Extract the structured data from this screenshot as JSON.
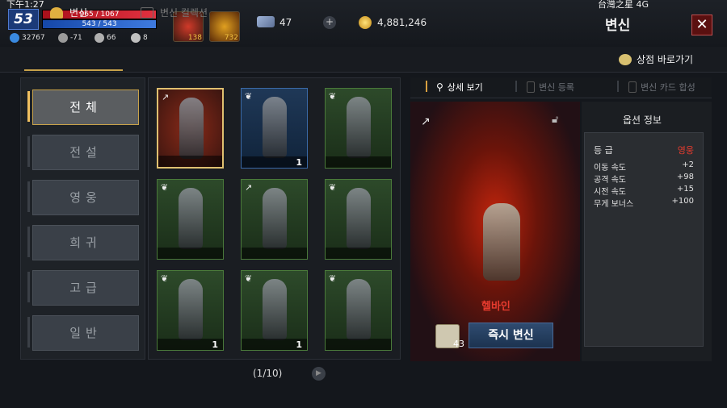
{
  "status_bar": {
    "clock": "下午1:27",
    "network": "台灣之星 4G"
  },
  "hud": {
    "level": "53",
    "hp": "965 / 1067",
    "mp": "543 / 543",
    "stats": [
      {
        "icon": "wing-icon",
        "value": "32767"
      },
      {
        "icon": "skull-icon",
        "value": "-71"
      },
      {
        "icon": "boot-icon",
        "value": "66"
      },
      {
        "icon": "claw-icon",
        "value": "8"
      }
    ],
    "potions": [
      {
        "icon": "red-potion-icon",
        "count": "138"
      },
      {
        "icon": "feather-leaf-icon",
        "count": "732"
      }
    ],
    "feather_count": "47",
    "plus": "+",
    "gold": "4,881,246",
    "title": "변신",
    "close": "✕"
  },
  "tabs": {
    "transform": "변신",
    "collection": "변신 컬렉션",
    "shop": "상점 바로가기"
  },
  "filters": [
    "전체",
    "전설",
    "영웅",
    "희귀",
    "고급",
    "일반"
  ],
  "cards": [
    {
      "class": "↗",
      "tier": "red",
      "count": ""
    },
    {
      "class": "❦",
      "tier": "blue",
      "count": "1"
    },
    {
      "class": "❦",
      "tier": "green",
      "count": ""
    },
    {
      "class": "❦",
      "tier": "green",
      "count": ""
    },
    {
      "class": "↗",
      "tier": "green",
      "count": ""
    },
    {
      "class": "❦",
      "tier": "green",
      "count": ""
    },
    {
      "class": "❦",
      "tier": "green",
      "count": "1"
    },
    {
      "class": "❦",
      "tier": "green",
      "count": "1"
    },
    {
      "class": "❦",
      "tier": "green",
      "count": ""
    }
  ],
  "pagination": "(1/10)",
  "detail_tabs": {
    "detail": "상세 보기",
    "register": "변신 등록",
    "cardmerge": "변신 카드 합성"
  },
  "preview": {
    "name": "헬바인",
    "scroll_count": "43",
    "transform_button": "즉시 변신"
  },
  "options": {
    "title": "옵션 정보",
    "grade_label": "등 급",
    "grade_value": "영웅",
    "rows": [
      {
        "label": "이동 속도",
        "value": "+2"
      },
      {
        "label": "공격 속도",
        "value": "+98"
      },
      {
        "label": "시전 속도",
        "value": "+15"
      },
      {
        "label": "무게 보너스",
        "value": "+100"
      }
    ]
  },
  "colors": {
    "accent": "#c8a24a",
    "hero": "#e63b2e",
    "hp": "#e23140",
    "mp": "#3f7be0"
  }
}
